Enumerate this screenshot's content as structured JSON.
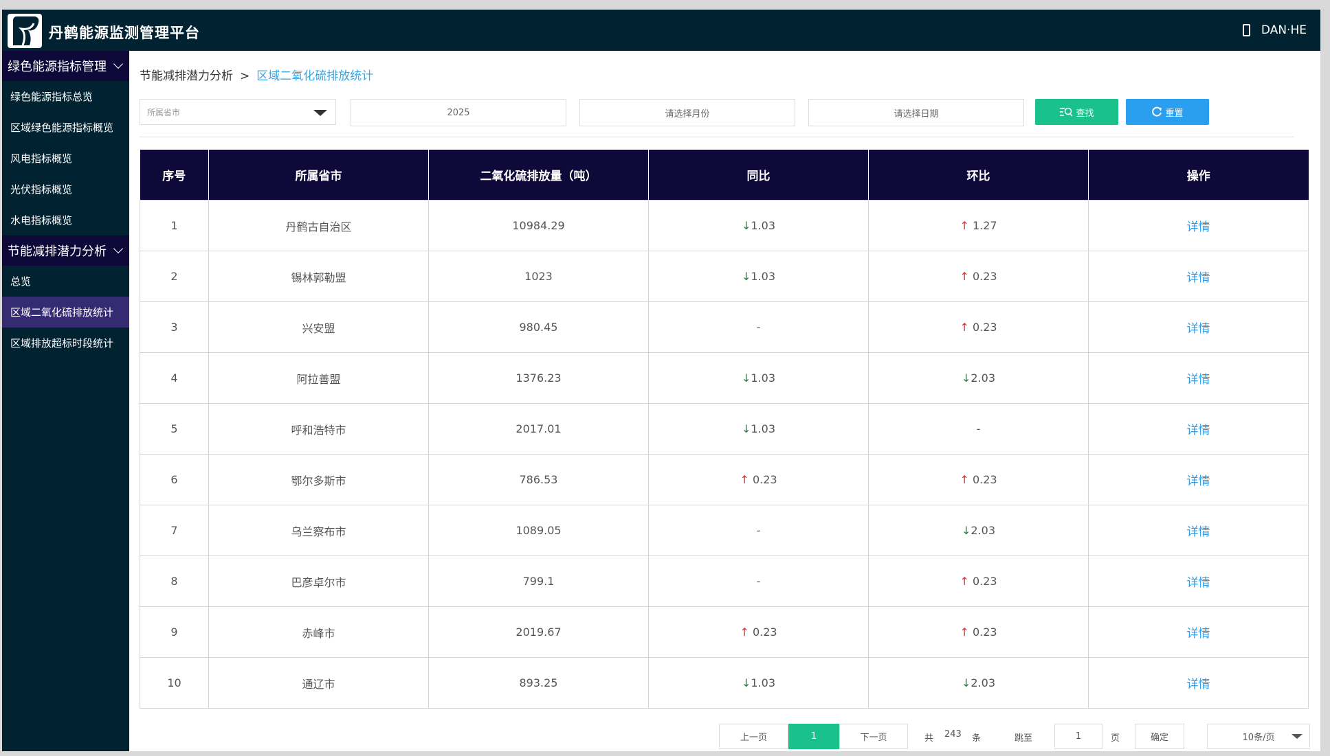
{
  "app": {
    "title": "丹鹤能源监测管理平台",
    "user": "DAN·HE"
  },
  "sidebar": {
    "groups": [
      {
        "label": "绿色能源指标管理",
        "items": [
          "绿色能源指标总览",
          "区域绿色能源指标概览",
          "风电指标概览",
          "光伏指标概览",
          "水电指标概览"
        ]
      },
      {
        "label": "节能减排潜力分析",
        "items": [
          "总览",
          "区域二氧化硫排放统计",
          "区域排放超标时段统计"
        ]
      }
    ],
    "active_item": "区域二氧化硫排放统计"
  },
  "breadcrumb": {
    "parent": "节能减排潜力分析",
    "separator": ">",
    "current": "区域二氧化硫排放统计"
  },
  "filters": {
    "province_placeholder": "所属省市",
    "year_value": "2025",
    "month_placeholder": "请选择月份",
    "date_placeholder": "请选择日期",
    "search_label": "查找",
    "reset_label": "重置"
  },
  "table": {
    "headers": [
      "序号",
      "所属省市",
      "二氧化硫排放量（吨）",
      "同比",
      "环比",
      "操作"
    ],
    "rows": [
      {
        "no": "1",
        "region": "丹鹤古自治区",
        "amount": "10984.29",
        "yoy_dir": "down",
        "yoy": "1.03",
        "mom_dir": "up",
        "mom": "1.27",
        "action": "详情"
      },
      {
        "no": "2",
        "region": "锡林郭勒盟",
        "amount": "1023",
        "yoy_dir": "down",
        "yoy": "1.03",
        "mom_dir": "up",
        "mom": "0.23",
        "action": "详情"
      },
      {
        "no": "3",
        "region": "兴安盟",
        "amount": "980.45",
        "yoy_dir": "none",
        "yoy": "-",
        "mom_dir": "up",
        "mom": "0.23",
        "action": "详情"
      },
      {
        "no": "4",
        "region": "阿拉善盟",
        "amount": "1376.23",
        "yoy_dir": "down",
        "yoy": "1.03",
        "mom_dir": "down",
        "mom": "2.03",
        "action": "详情"
      },
      {
        "no": "5",
        "region": "呼和浩特市",
        "amount": "2017.01",
        "yoy_dir": "down",
        "yoy": "1.03",
        "mom_dir": "none",
        "mom": "-",
        "action": "详情"
      },
      {
        "no": "6",
        "region": "鄂尔多斯市",
        "amount": "786.53",
        "yoy_dir": "up",
        "yoy": "0.23",
        "mom_dir": "up",
        "mom": "0.23",
        "action": "详情"
      },
      {
        "no": "7",
        "region": "乌兰察布市",
        "amount": "1089.05",
        "yoy_dir": "none",
        "yoy": "-",
        "mom_dir": "down",
        "mom": "2.03",
        "action": "详情"
      },
      {
        "no": "8",
        "region": "巴彦卓尔市",
        "amount": "799.1",
        "yoy_dir": "none",
        "yoy": "-",
        "mom_dir": "up",
        "mom": "0.23",
        "action": "详情"
      },
      {
        "no": "9",
        "region": "赤峰市",
        "amount": "2019.67",
        "yoy_dir": "up",
        "yoy": "0.23",
        "mom_dir": "up",
        "mom": "0.23",
        "action": "详情"
      },
      {
        "no": "10",
        "region": "通辽市",
        "amount": "893.25",
        "yoy_dir": "down",
        "yoy": "1.03",
        "mom_dir": "down",
        "mom": "2.03",
        "action": "详情"
      }
    ],
    "arrows": {
      "up": "↑",
      "down": "↓"
    },
    "colors": {
      "up": "#ef2b2b",
      "down": "#1e7d3c"
    }
  },
  "pagination": {
    "prev_label": "上一页",
    "current_page": "1",
    "next_label": "下一页",
    "total_prefix": "共",
    "total": "243",
    "total_suffix": "条",
    "jump_label": "跳至",
    "jump_value": "1",
    "page_suffix": "页",
    "confirm_label": "确定",
    "page_size": "10条/页"
  },
  "colors": {
    "header_bg": "#012231",
    "menu_group_bg": "#0e0938",
    "active_item_bg": "#352b73",
    "search_btn": "#1bc18b",
    "reset_btn": "#2a9fef",
    "link": "#2d9be6"
  }
}
